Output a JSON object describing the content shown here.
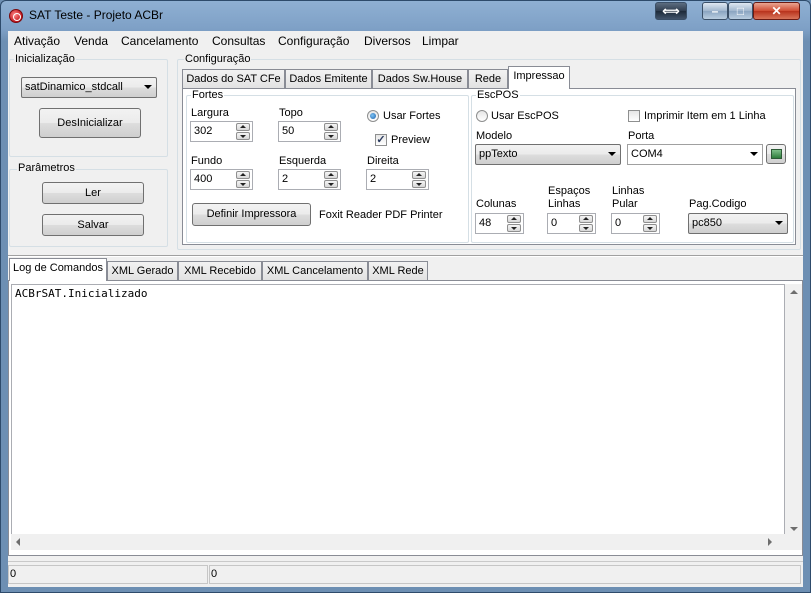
{
  "window": {
    "title": "SAT Teste - Projeto ACBr",
    "caption_buttons": {
      "swap": "⟺",
      "minimize": "–",
      "maximize": "□",
      "close": "✕"
    }
  },
  "menu": [
    {
      "label": "Ativação"
    },
    {
      "label": "Venda"
    },
    {
      "label": "Cancelamento"
    },
    {
      "label": "Consultas"
    },
    {
      "label": "Configuração"
    },
    {
      "label": "Diversos"
    },
    {
      "label": "Limpar"
    }
  ],
  "inicializacao": {
    "caption": "Inicialização",
    "library_select": "satDinamico_stdcall",
    "desinicializar_label": "DesInicializar"
  },
  "parametros": {
    "caption": "Parâmetros",
    "ler_label": "Ler",
    "salvar_label": "Salvar"
  },
  "configuracao": {
    "caption": "Configuração",
    "tabs": [
      {
        "label": "Dados do SAT CFe"
      },
      {
        "label": "Dados Emitente"
      },
      {
        "label": "Dados Sw.House"
      },
      {
        "label": "Rede"
      },
      {
        "label": "Impressao"
      }
    ],
    "active_tab": "Impressao",
    "fortes": {
      "caption": "Fortes",
      "largura_label": "Largura",
      "largura_value": "302",
      "topo_label": "Topo",
      "topo_value": "50",
      "fundo_label": "Fundo",
      "fundo_value": "400",
      "esquerda_label": "Esquerda",
      "esquerda_value": "2",
      "direita_label": "Direita",
      "direita_value": "2",
      "usar_fortes_label": "Usar Fortes",
      "usar_fortes_checked": true,
      "preview_label": "Preview",
      "preview_checked": true,
      "definir_impressora_label": "Definir Impressora",
      "printer_name": "Foxit Reader PDF Printer"
    },
    "escpos": {
      "caption": "EscPOS",
      "usar_escpos_label": "Usar EscPOS",
      "usar_escpos_checked": false,
      "imprimir_item_label": "Imprimir Item em 1 Linha",
      "imprimir_item_checked": false,
      "modelo_label": "Modelo",
      "modelo_value": "ppTexto",
      "porta_label": "Porta",
      "porta_value": "COM4",
      "colunas_label": "Colunas",
      "colunas_value": "48",
      "espacos_linhas_label_1": "Espaços",
      "espacos_linhas_label_2": "Linhas",
      "espacos_linhas_value": "0",
      "linhas_pular_label_1": "Linhas",
      "linhas_pular_label_2": "Pular",
      "linhas_pular_value": "0",
      "pagcodigo_label": "Pag.Codigo",
      "pagcodigo_value": "pc850"
    }
  },
  "log_tabs": [
    {
      "label": "Log de Comandos"
    },
    {
      "label": "XML Gerado"
    },
    {
      "label": "XML Recebido"
    },
    {
      "label": "XML Cancelamento"
    },
    {
      "label": "XML Rede"
    }
  ],
  "log_active_tab": "Log de Comandos",
  "log_text": "ACBrSAT.Inicializado",
  "statusbar": {
    "panel1": "0",
    "panel2": "0"
  }
}
